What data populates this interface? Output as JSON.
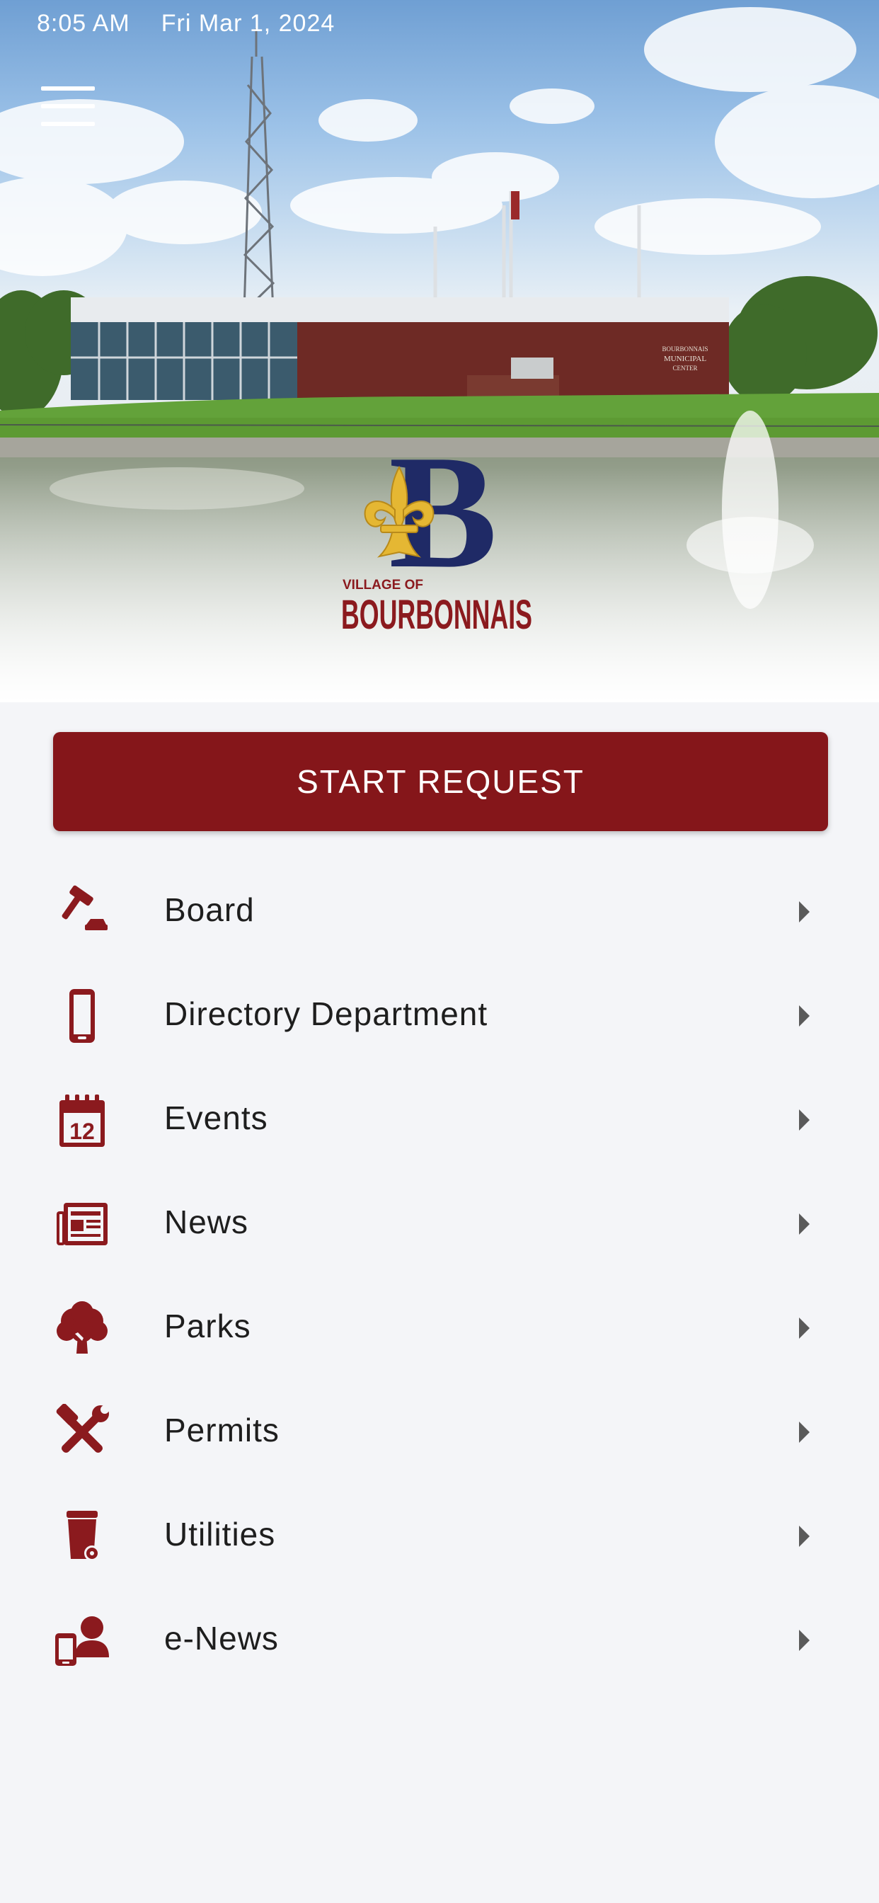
{
  "status_bar": {
    "time": "8:05 AM",
    "date": "Fri Mar 1, 2024"
  },
  "logo": {
    "line1": "VILLAGE OF",
    "line2": "BOURBONNAIS",
    "letter": "B"
  },
  "building_sign": {
    "line1": "BOURBONNAIS",
    "line2": "MUNICIPAL",
    "line3": "CENTER"
  },
  "start_request": {
    "label": "START REQUEST"
  },
  "menu": {
    "items": [
      {
        "label": "Board",
        "icon": "gavel-icon"
      },
      {
        "label": "Directory Department",
        "icon": "mobile-phone-icon"
      },
      {
        "label": "Events",
        "icon": "calendar-icon"
      },
      {
        "label": "News",
        "icon": "newspaper-icon"
      },
      {
        "label": "Parks",
        "icon": "tree-icon"
      },
      {
        "label": "Permits",
        "icon": "tools-icon"
      },
      {
        "label": "Utilities",
        "icon": "trash-bin-icon"
      },
      {
        "label": "e-News",
        "icon": "mobile-user-icon"
      }
    ]
  },
  "colors": {
    "accent": "#85161a",
    "icon": "#8b1a1e",
    "background": "#f4f5f8",
    "logo_blue": "#1f2a66",
    "logo_gold": "#e5b733"
  }
}
